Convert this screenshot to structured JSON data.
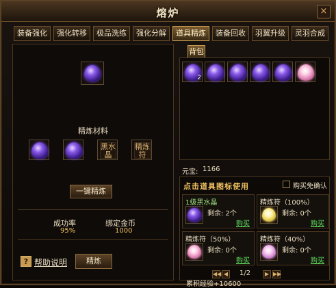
{
  "window": {
    "title": "熔炉",
    "close_symbol": "×"
  },
  "tabs": [
    {
      "label": "装备强化",
      "active": false
    },
    {
      "label": "强化转移",
      "active": false
    },
    {
      "label": "极品洗练",
      "active": false
    },
    {
      "label": "强化分解",
      "active": false
    },
    {
      "label": "道具精炼",
      "active": true
    },
    {
      "label": "装备回收",
      "active": false
    },
    {
      "label": "羽翼升级",
      "active": false
    },
    {
      "label": "灵羽合成",
      "active": false
    }
  ],
  "refine": {
    "materials_title": "精炼材料",
    "materials": [
      {
        "kind": "gem"
      },
      {
        "kind": "gem"
      },
      {
        "kind": "text",
        "text": "黑水晶"
      },
      {
        "kind": "text",
        "text": "精炼符"
      }
    ],
    "one_key_button": "一键精炼",
    "success_rate_label": "成功率",
    "success_rate_value": "95%",
    "bound_gold_label": "绑定金币",
    "bound_gold_value": "1000",
    "help_icon_text": "?",
    "help_link": "帮助说明",
    "refine_button": "精炼"
  },
  "bag": {
    "tab_label": "背包",
    "items": [
      {
        "kind": "gem",
        "count": "2"
      },
      {
        "kind": "gem",
        "count": ""
      },
      {
        "kind": "gem",
        "count": ""
      },
      {
        "kind": "gem",
        "count": ""
      },
      {
        "kind": "gem",
        "count": ""
      },
      {
        "kind": "talisman",
        "count": ""
      }
    ],
    "yuanbao_label": "元宝:",
    "yuanbao_value": "1166"
  },
  "quick_buy": {
    "heading": "点击道具图标使用",
    "auto_confirm_label": "购买免确认",
    "items": [
      {
        "name": "1级黑水晶",
        "left": "剩余: 2个",
        "buy": "购买",
        "icon": "gem",
        "green": true
      },
      {
        "name": "精炼符（100%）",
        "left": "剩余: 0个",
        "buy": "购买",
        "icon": "yellow",
        "green": false
      },
      {
        "name": "精炼符（50%）",
        "left": "剩余: 0个",
        "buy": "购买",
        "icon": "talisman",
        "green": false
      },
      {
        "name": "精炼符（40%）",
        "left": "剩余: 0个",
        "buy": "购买",
        "icon": "pink",
        "green": false
      }
    ],
    "page": "1/2",
    "exp_text": "累积经验+10600"
  },
  "colors": {
    "accent": "#f0c060",
    "buy_link": "#60e060",
    "frame": "#5a4226"
  }
}
